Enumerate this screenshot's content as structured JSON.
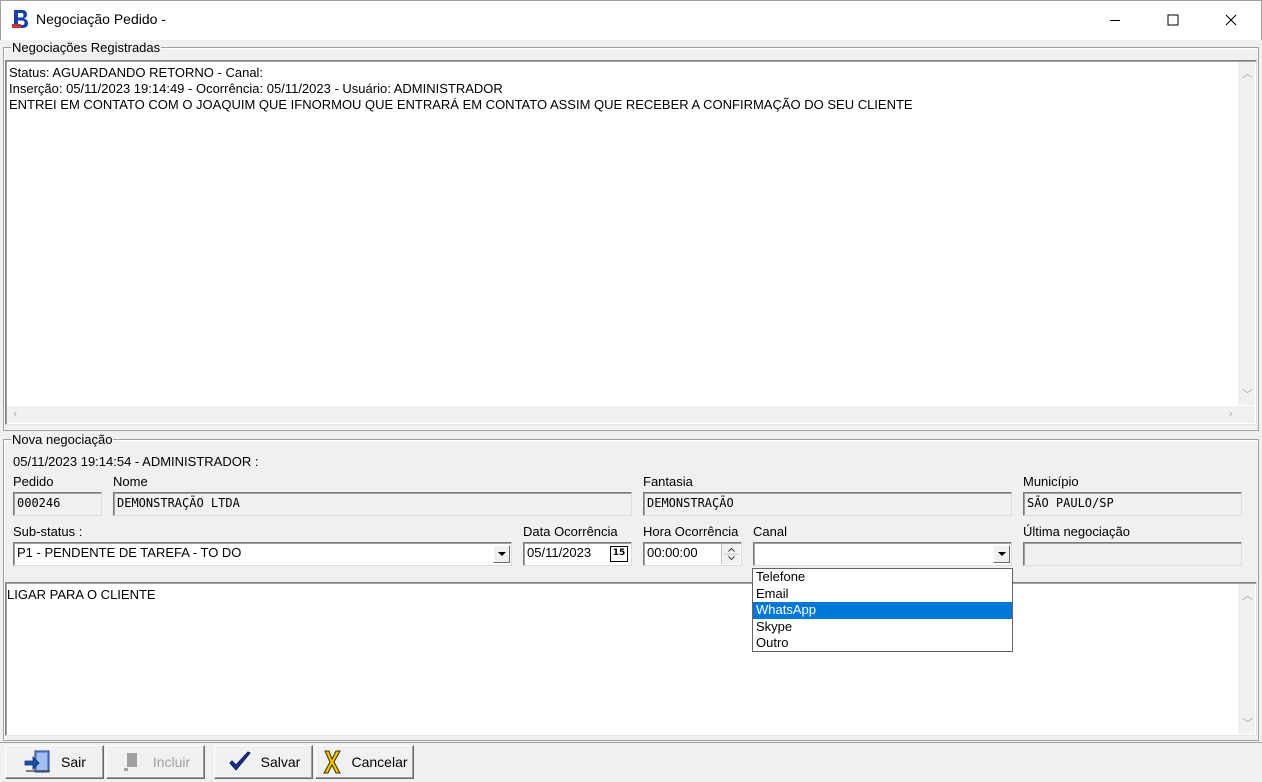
{
  "window": {
    "title": "Negociação Pedido -",
    "controls": [
      "minimize-icon",
      "maximize-icon",
      "close-icon"
    ]
  },
  "registered": {
    "legend": "Negociações Registradas",
    "lines": [
      "Status: AGUARDANDO RETORNO - Canal:",
      "Inserção: 05/11/2023 19:14:49 - Ocorrência: 05/11/2023 - Usuário: ADMINISTRADOR",
      "ENTREI EM CONTATO COM O JOAQUIM QUE IFNORMOU QUE ENTRARÁ EM CONTATO ASSIM QUE RECEBER A CONFIRMAÇÃO DO SEU CLIENTE"
    ]
  },
  "new": {
    "legend": "Nova negociação",
    "header": "05/11/2023 19:14:54 - ADMINISTRADOR :",
    "pedido": {
      "label": "Pedido",
      "value": "000246"
    },
    "nome": {
      "label": "Nome",
      "value": "DEMONSTRAÇÃO LTDA"
    },
    "fantasia": {
      "label": "Fantasia",
      "value": "DEMONSTRAÇÃO"
    },
    "municipio": {
      "label": "Município",
      "value": "SÃO PAULO/SP"
    },
    "substatus": {
      "label": "Sub-status :",
      "value": "P1 - PENDENTE DE TAREFA - TO DO"
    },
    "data": {
      "label": "Data Ocorrência",
      "value": "05/11/2023",
      "calendar_day": "15"
    },
    "hora": {
      "label": "Hora Ocorrência",
      "value": "00:00:00"
    },
    "canal": {
      "label": "Canal",
      "value": "",
      "options": [
        "Telefone",
        "Email",
        "WhatsApp",
        "Skype",
        "Outro"
      ],
      "highlighted": "WhatsApp"
    },
    "ultima": {
      "label": "Última negociação",
      "value": ""
    },
    "note": "LIGAR PARA O CLIENTE"
  },
  "toolbar": {
    "sair": "Sair",
    "incluir": "Incluir",
    "salvar": "Salvar",
    "cancelar": "Cancelar"
  }
}
